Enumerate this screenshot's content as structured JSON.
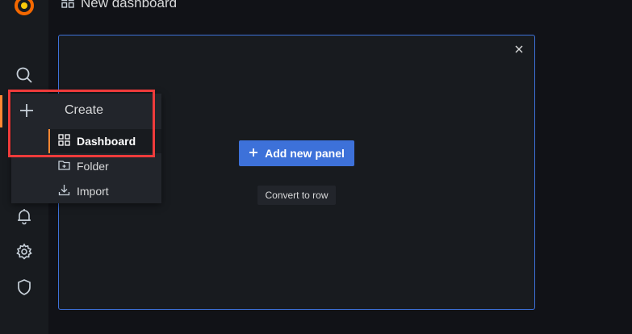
{
  "topbar": {
    "title": "New dashboard",
    "icon": "dashboard-grid-icon"
  },
  "sidebar": {
    "items": [
      {
        "name": "grafana-logo",
        "icon": "grafana-logo-icon"
      },
      {
        "name": "search",
        "icon": "search-icon"
      },
      {
        "name": "create",
        "icon": "plus-icon",
        "active": true
      },
      {
        "name": "dashboards",
        "icon": "dashboards-grid-icon"
      },
      {
        "name": "explore",
        "icon": "compass-icon"
      },
      {
        "name": "alerting",
        "icon": "bell-icon"
      },
      {
        "name": "configuration",
        "icon": "gear-icon"
      },
      {
        "name": "server-admin",
        "icon": "shield-icon"
      }
    ]
  },
  "create_menu": {
    "header": "Create",
    "items": [
      {
        "label": "Dashboard",
        "icon": "dashboard-grid-icon",
        "active": true
      },
      {
        "label": "Folder",
        "icon": "folder-plus-icon"
      },
      {
        "label": "Import",
        "icon": "import-icon"
      }
    ]
  },
  "panel": {
    "add_button_label": "Add new panel",
    "convert_button_label": "Convert to row",
    "close_icon": "close-icon"
  },
  "colors": {
    "background": "#111217",
    "sidebar": "#181b1f",
    "panel_border": "#3d71d9",
    "primary_button": "#3d71d9",
    "accent": "#ff8833",
    "highlight": "#ef3b3b"
  }
}
